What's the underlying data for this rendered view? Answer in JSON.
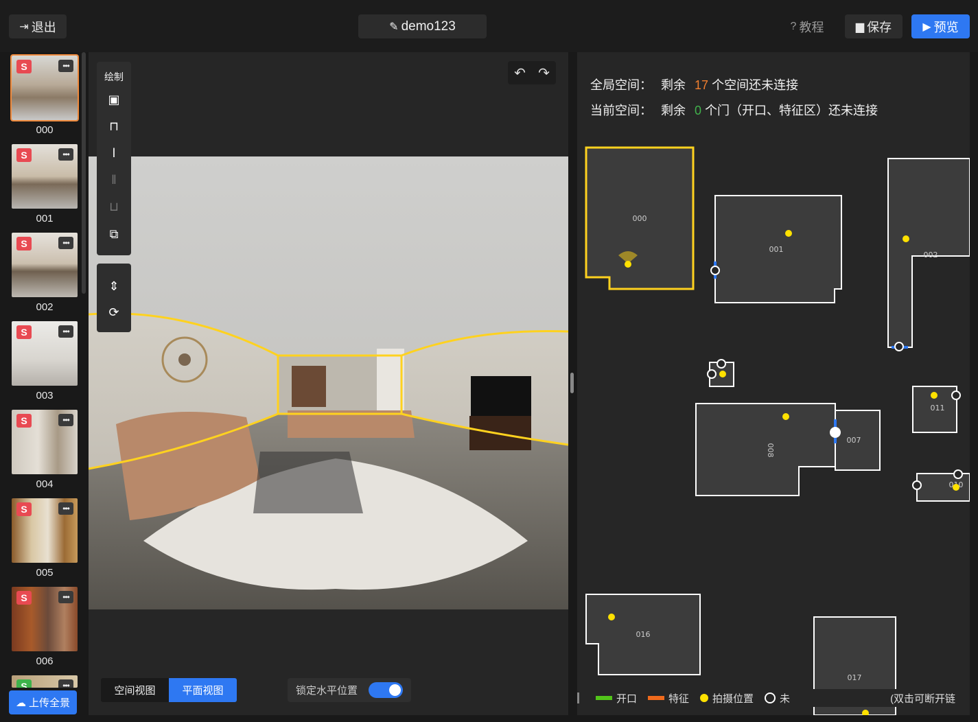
{
  "header": {
    "exit_label": "退出",
    "project_title": "demo123",
    "tutorial_label": "教程",
    "save_label": "保存",
    "preview_label": "预览"
  },
  "sidebar": {
    "items": [
      {
        "label": "000",
        "selected": true
      },
      {
        "label": "001"
      },
      {
        "label": "002"
      },
      {
        "label": "003"
      },
      {
        "label": "004"
      },
      {
        "label": "005"
      },
      {
        "label": "006"
      }
    ],
    "upload_label": "上传全景"
  },
  "viewer": {
    "toolbar_title": "绘制",
    "view_tabs": [
      {
        "label": "空间视图",
        "active": false
      },
      {
        "label": "平面视图",
        "active": true
      }
    ],
    "lock_label": "锁定水平位置",
    "lock_on": true
  },
  "plan": {
    "global_prefix": "全局空间：",
    "global_remaining": "剩余",
    "global_count": "17",
    "global_suffix": "个空间还未连接",
    "current_prefix": "当前空间：",
    "current_remaining": "剩余",
    "current_count": "0",
    "current_suffix": "个门（开口、特征区）还未连接",
    "rooms": [
      "000",
      "001",
      "002",
      "007",
      "008",
      "016",
      "017",
      "011",
      "010"
    ],
    "legend": [
      {
        "label": "开口",
        "color": "#52c41a"
      },
      {
        "label": "特征",
        "color": "#f06a1c"
      },
      {
        "label": "拍摄位置",
        "color": "#ffe100"
      },
      {
        "label": "未",
        "color": "#ffffff"
      }
    ],
    "legend_hint": "(双击可断开链"
  },
  "colors": {
    "accent": "#2e78f2",
    "selected_border": "#f08a3c",
    "room_selected": "#ffd21f"
  }
}
